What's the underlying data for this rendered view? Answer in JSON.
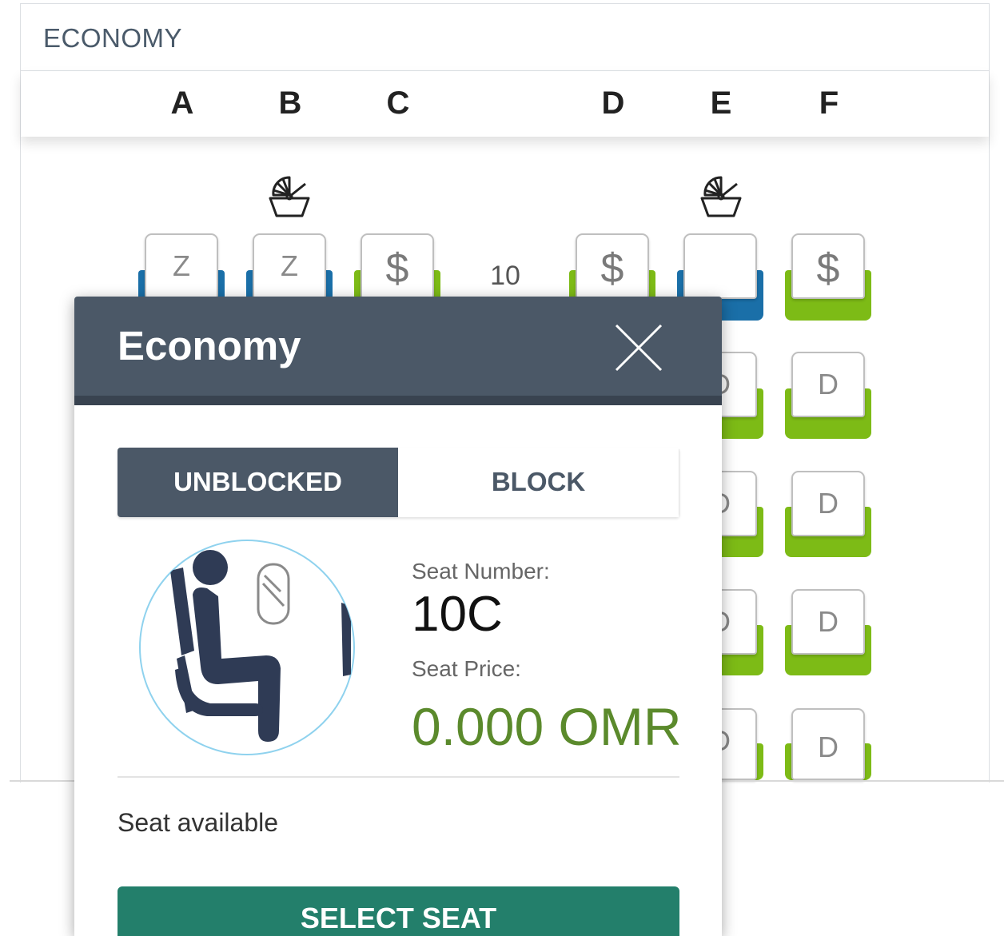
{
  "cabin": {
    "title": "ECONOMY",
    "columns": [
      "A",
      "B",
      "C",
      "D",
      "E",
      "F"
    ],
    "row_label": "10"
  },
  "seats": {
    "row10": [
      {
        "col": "A",
        "mark": "Z",
        "type": "blue"
      },
      {
        "col": "B",
        "mark": "Z",
        "type": "blue"
      },
      {
        "col": "C",
        "mark": "$",
        "type": "green"
      },
      {
        "col": "D",
        "mark": "$",
        "type": "green"
      },
      {
        "col": "E",
        "mark": "",
        "type": "blue"
      },
      {
        "col": "F",
        "mark": "$",
        "type": "green"
      }
    ],
    "lower_rows_mark": "D"
  },
  "popup": {
    "title": "Economy",
    "toggle_on": "UNBLOCKED",
    "toggle_off": "BLOCK",
    "seat_number_label": "Seat Number:",
    "seat_number": "10C",
    "seat_price_label": "Seat Price:",
    "seat_price": "0.000 OMR",
    "status": "Seat available",
    "select_button": "SELECT SEAT"
  },
  "colors": {
    "header": "#4b5867",
    "available_green": "#7dbb16",
    "blocked_blue": "#1a6fa8",
    "price_green": "#5b8a2c",
    "select_button": "#237f6b"
  },
  "icons": [
    "bassinet-icon",
    "close-icon",
    "seated-passenger-icon",
    "window-icon"
  ]
}
